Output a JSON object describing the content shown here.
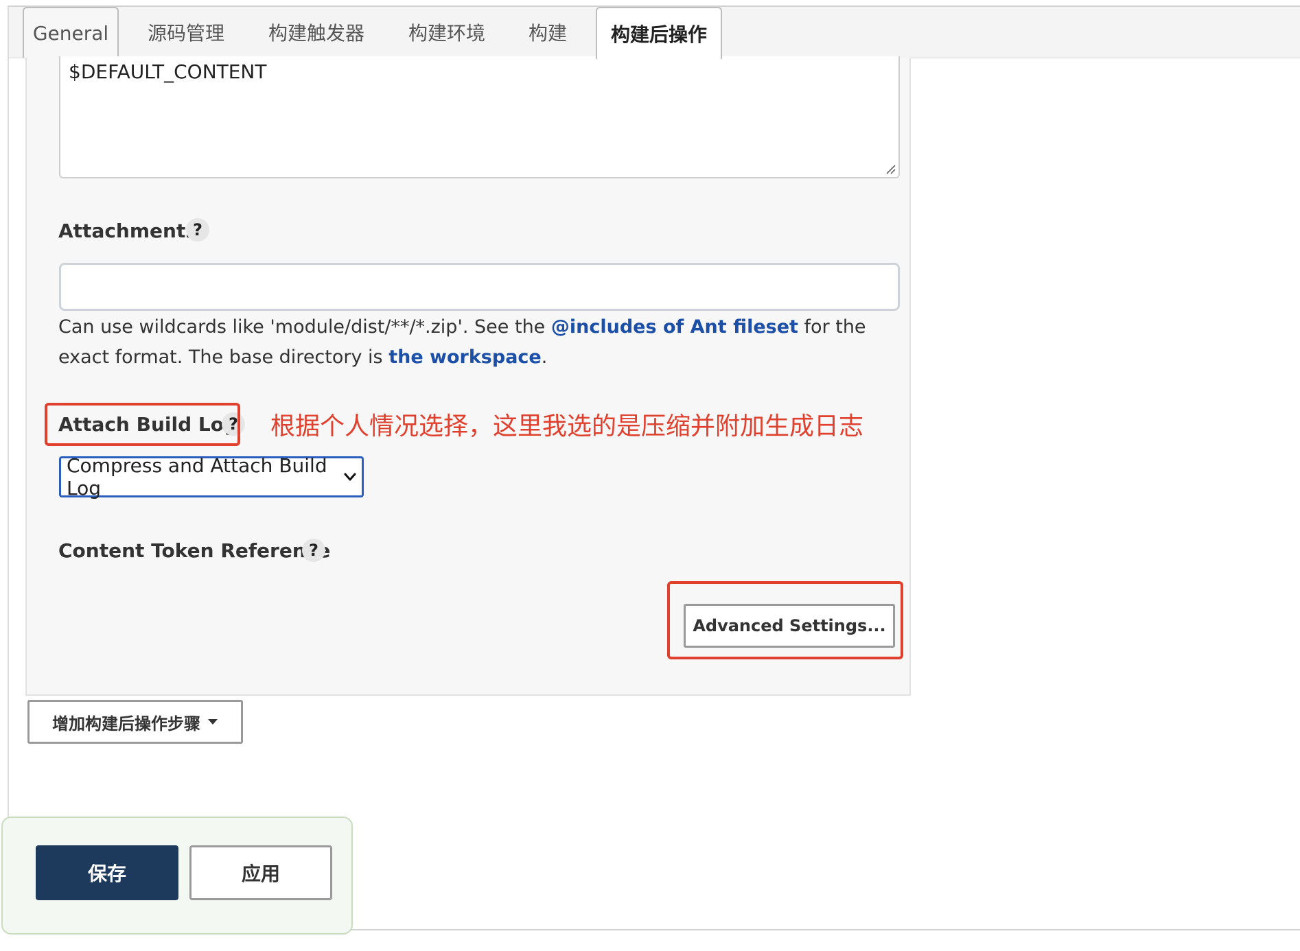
{
  "tabs": [
    {
      "label": "General",
      "active": false
    },
    {
      "label": "源码管理",
      "active": false
    },
    {
      "label": "构建触发器",
      "active": false
    },
    {
      "label": "构建环境",
      "active": false
    },
    {
      "label": "构建",
      "active": false
    },
    {
      "label": "构建后操作",
      "active": true
    }
  ],
  "content_field": {
    "value": "$DEFAULT_CONTENT"
  },
  "attachments": {
    "label": "Attachments",
    "help": "?",
    "value": "",
    "desc_prefix": "Can use wildcards like 'module/dist/**/*.zip'. See the ",
    "desc_link1": "@includes of Ant fileset",
    "desc_mid": " for the exact format. The base directory is ",
    "desc_link2": "the workspace",
    "desc_suffix": "."
  },
  "attach_build_log": {
    "label": "Attach Build Log",
    "help": "?",
    "selected": "Compress and Attach Build Log"
  },
  "annotation": {
    "text": "根据个人情况选择，这里我选的是压缩并附加生成日志",
    "color": "#e0402e"
  },
  "content_token": {
    "label": "Content Token Reference",
    "help": "?"
  },
  "advanced_button": {
    "label": "Advanced Settings..."
  },
  "add_step_button": {
    "label": "增加构建后操作步骤"
  },
  "footer": {
    "save_label": "保存",
    "apply_label": "应用"
  },
  "colors": {
    "primary": "#1d3a5c",
    "link": "#1b4fa8",
    "highlight": "#e0402e",
    "select_border": "#2a5fbf"
  },
  "icons": {
    "dropdown": "chevron-down-icon",
    "add_dropdown": "caret-down-icon",
    "resize": "resize-grip-icon"
  }
}
